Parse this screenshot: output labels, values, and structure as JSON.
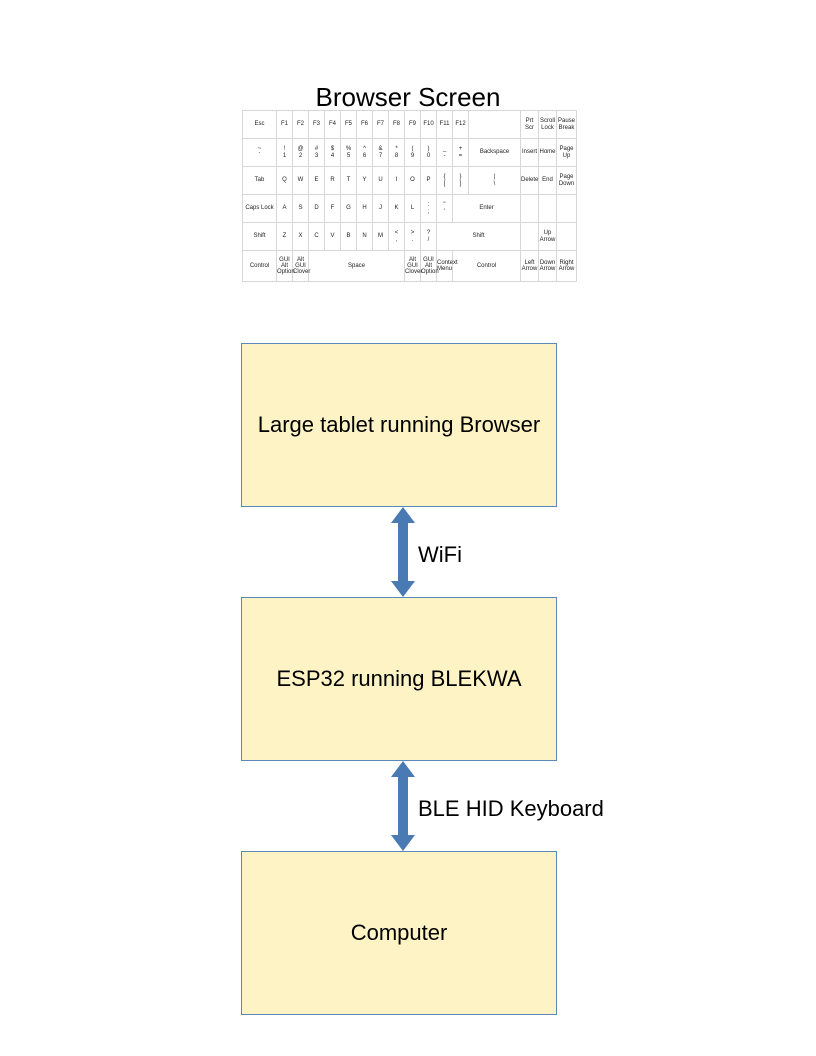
{
  "title": "Browser Screen",
  "boxes": {
    "tablet": "Large tablet running Browser",
    "esp32": "ESP32 running BLEKWA",
    "computer": "Computer"
  },
  "links": {
    "wifi": "WiFi",
    "blehid": "BLE HID Keyboard"
  },
  "keyboard": {
    "row1": [
      "Esc",
      "F1",
      "F2",
      "F3",
      "F4",
      "F5",
      "F6",
      "F7",
      "F8",
      "F9",
      "F10",
      "F11",
      "F12",
      "",
      "Prt Scr",
      "Scroll Lock",
      "Pause Break"
    ],
    "row2": [
      "~\n`",
      "!\n1",
      "@\n2",
      "#\n3",
      "$\n4",
      "%\n5",
      "^\n6",
      "&\n7",
      "*\n8",
      "(\n9",
      ")\n0",
      "_\n-",
      "+\n=",
      "Backspace",
      "Insert",
      "Home",
      "Page Up"
    ],
    "row3": [
      "Tab",
      "Q",
      "W",
      "E",
      "R",
      "T",
      "Y",
      "U",
      "I",
      "O",
      "P",
      "{\n[",
      "}\n]",
      "|\n\\",
      "Delete",
      "End",
      "Page Down"
    ],
    "row4": [
      "Caps Lock",
      "A",
      "S",
      "D",
      "F",
      "G",
      "H",
      "J",
      "K",
      "L",
      ":\n;",
      "\"\n'",
      "Enter",
      "",
      "",
      ""
    ],
    "row5": [
      "Shift",
      "Z",
      "X",
      "C",
      "V",
      "B",
      "N",
      "M",
      "<\n,",
      ">\n.",
      "?\n/",
      "Shift",
      "",
      "Up Arrow",
      ""
    ],
    "row6": [
      "Control",
      "GUI Alt Option",
      "Alt GUI Clover",
      "Space",
      "Alt GUI Clover",
      "GUI Alt Option",
      "Context Menu",
      "Control",
      "Left Arrow",
      "Down Arrow",
      "Right Arrow"
    ]
  }
}
